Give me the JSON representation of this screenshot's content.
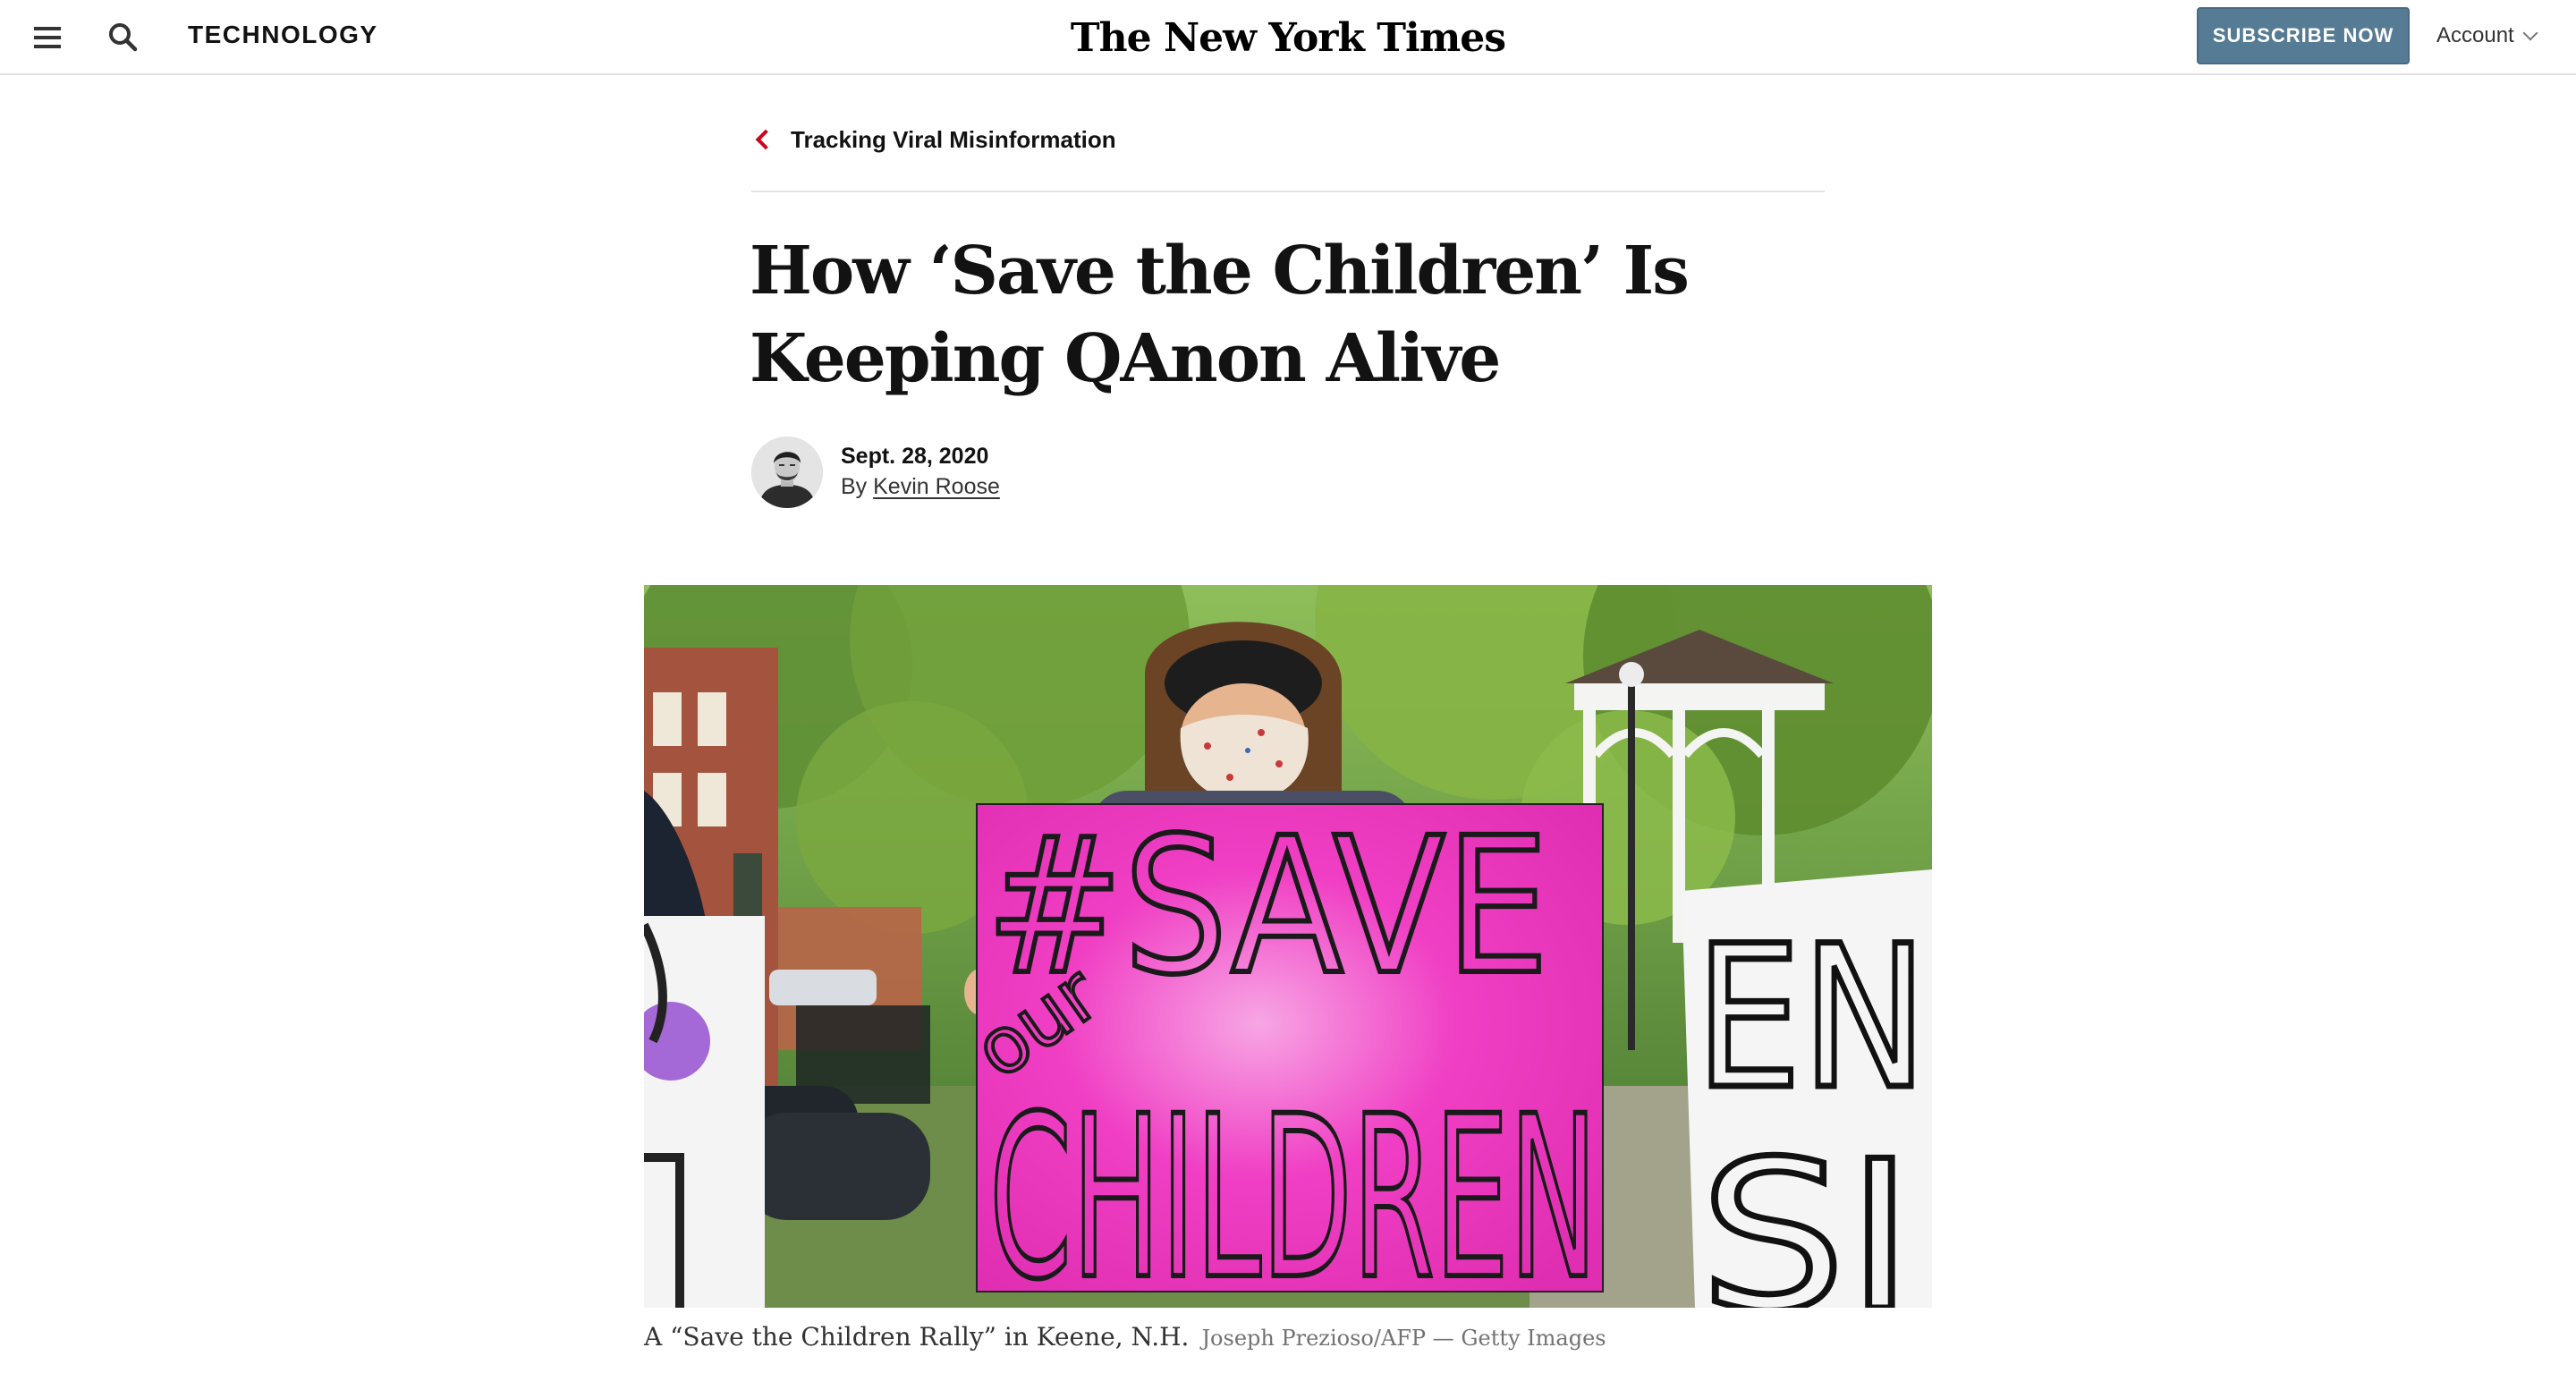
{
  "header": {
    "menu_icon": "hamburger-menu-icon",
    "search_icon": "search-icon",
    "section": "TECHNOLOGY",
    "masthead": "The New York Times",
    "subscribe_label": "SUBSCRIBE NOW",
    "account_label": "Account",
    "account_icon": "chevron-down-icon"
  },
  "breadcrumb": {
    "icon": "chevron-left-icon",
    "label": "Tracking Viral Misinformation",
    "accent_color": "#d0021b"
  },
  "article": {
    "headline": "How ‘Save the Children’ Is Keeping QAnon Alive",
    "date": "Sept. 28, 2020",
    "byline_prefix": "By ",
    "author": "Kevin Roose"
  },
  "photo": {
    "sign_main_line1": "#SAVE",
    "sign_main_our": "our",
    "sign_main_line2": "CHILDREN",
    "sign_right_line1": "EN",
    "sign_right_line2": "SI",
    "caption": "A “Save the Children Rally” in Keene, N.H.",
    "credit": "Joseph Prezioso/AFP — Getty Images"
  },
  "colors": {
    "subscribe_bg": "#567b95",
    "sign_pink": "#f03fc4"
  }
}
